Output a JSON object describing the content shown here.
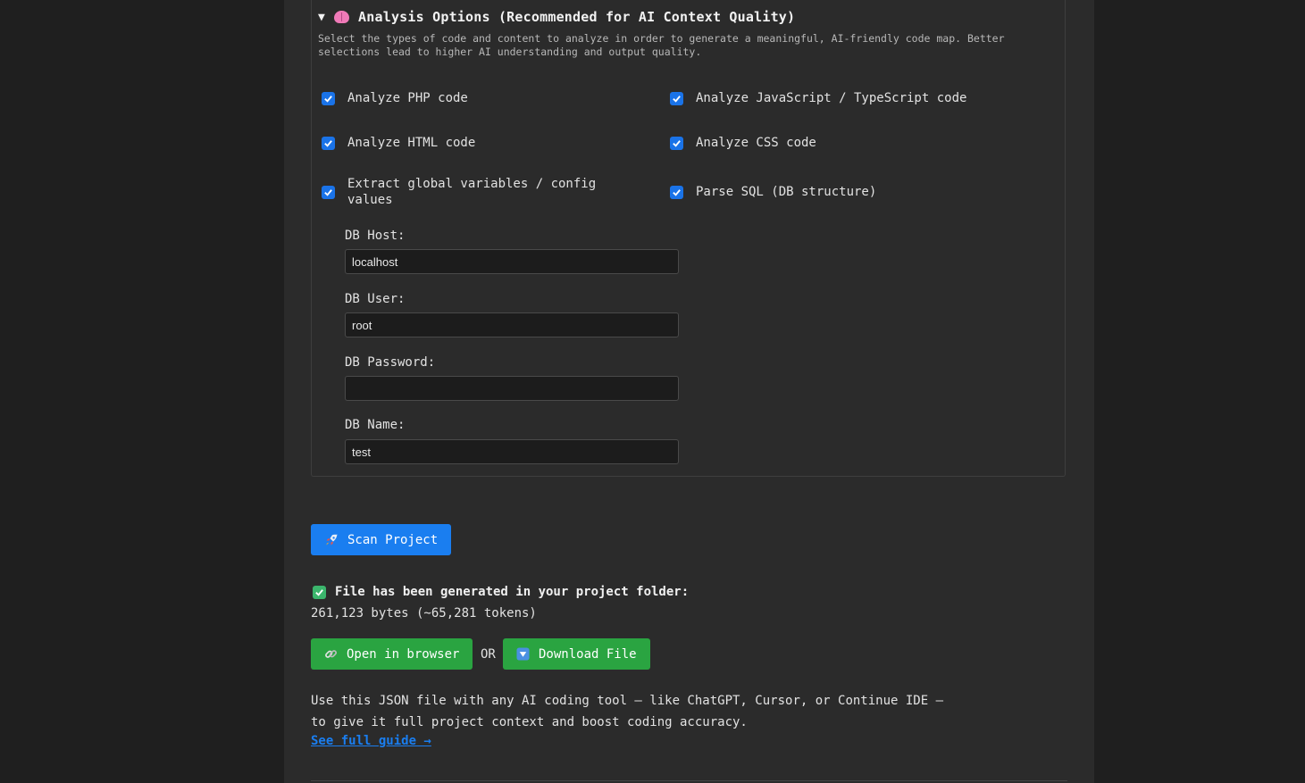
{
  "options": {
    "summary_title": "Analysis Options (Recommended for AI Context Quality)",
    "toggle_glyph": "▼",
    "icon": "brain-icon",
    "description": "Select the types of code and content to analyze in order to generate a meaningful, AI-friendly code map. Better selections lead to higher AI understanding and output quality.",
    "checkboxes": [
      {
        "label": "Analyze PHP code",
        "checked": true
      },
      {
        "label": "Analyze JavaScript / TypeScript code",
        "checked": true
      },
      {
        "label": "Analyze HTML code",
        "checked": true
      },
      {
        "label": "Analyze CSS code",
        "checked": true
      },
      {
        "label": "Extract global variables / config values",
        "checked": true
      },
      {
        "label": "Parse SQL (DB structure)",
        "checked": true
      }
    ],
    "db": {
      "host_label": "DB Host:",
      "host_value": "localhost",
      "user_label": "DB User:",
      "user_value": "root",
      "password_label": "DB Password:",
      "password_value": "",
      "name_label": "DB Name:",
      "name_value": "test"
    }
  },
  "scan_button": {
    "label": "Scan Project",
    "icon": "rocket-icon"
  },
  "result": {
    "status_text": "File has been generated in your project folder:",
    "size_text": "261,123 bytes (~65,281 tokens)",
    "open_label": "Open in browser",
    "or_text": "OR",
    "download_label": "Download File",
    "info_line1": "Use this JSON file with any AI coding tool — like ChatGPT, Cursor, or Continue IDE —",
    "info_line2": "to give it full project context and boost coding accuracy.",
    "guide_link": "See full guide →"
  },
  "colors": {
    "accent_blue": "#1a7ef0",
    "accent_green": "#2aa441",
    "background": "#2b2b2b"
  }
}
